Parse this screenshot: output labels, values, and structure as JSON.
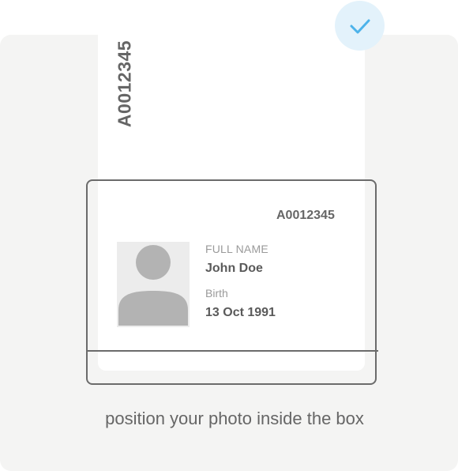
{
  "document": {
    "vertical_number": "A0012345",
    "card_number": "A0012345",
    "full_name_label": "FULL NAME",
    "full_name_value": "John Doe",
    "birth_label": "Birth",
    "birth_value": "13 Oct 1991"
  },
  "photo": {
    "icon": "avatar-placeholder-icon"
  },
  "confirm": {
    "icon": "checkmark-icon",
    "accent": "#4db3ea",
    "background": "#e3f2fb"
  },
  "hint": {
    "text": "position your photo inside the box"
  },
  "colors": {
    "panel": "#f4f4f3",
    "frame": "#6b6b6b",
    "text_dark": "#666666",
    "text_light": "#9a9a9a"
  }
}
